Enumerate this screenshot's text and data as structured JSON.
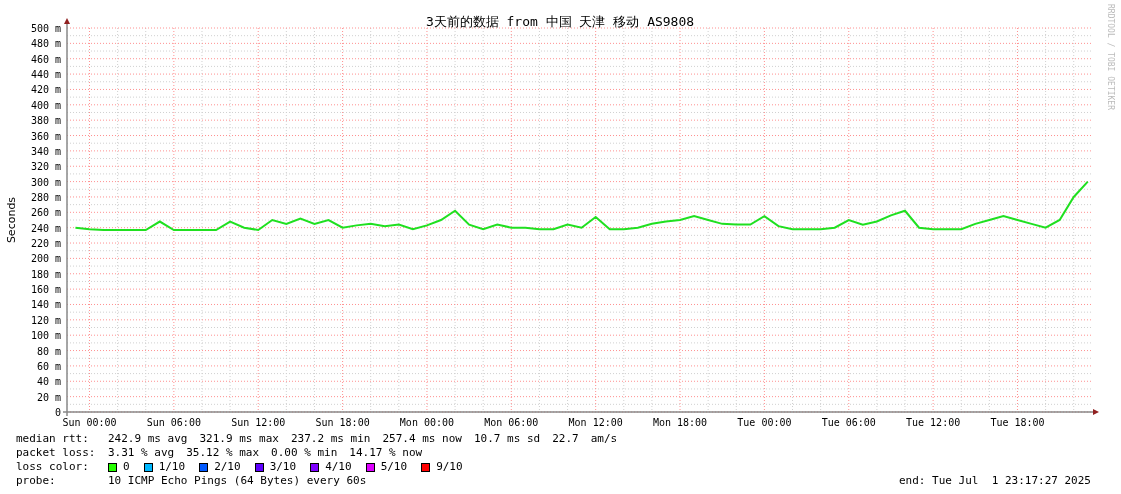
{
  "graph": {
    "watermark": "RRDTOOL / TOBI OETIKER",
    "chart_data": {
      "type": "line",
      "title": "3天前的数据 from 中国 天津 移动 AS9808",
      "ylabel": "Seconds",
      "categories": [
        null,
        "Sun 00:00",
        null,
        null,
        null,
        null,
        null,
        "Sun 06:00",
        null,
        null,
        null,
        null,
        null,
        "Sun 12:00",
        null,
        null,
        null,
        null,
        null,
        "Sun 18:00",
        null,
        null,
        null,
        null,
        null,
        "Mon 00:00",
        null,
        null,
        null,
        null,
        null,
        "Mon 06:00",
        null,
        null,
        null,
        null,
        null,
        "Mon 12:00",
        null,
        null,
        null,
        null,
        null,
        "Mon 18:00",
        null,
        null,
        null,
        null,
        null,
        "Tue 00:00",
        null,
        null,
        null,
        null,
        null,
        "Tue 06:00",
        null,
        null,
        null,
        null,
        null,
        "Tue 12:00",
        null,
        null,
        null,
        null,
        null,
        "Tue 18:00",
        null,
        null,
        null,
        null,
        null
      ],
      "series": [
        {
          "name": "median rtt:",
          "color": "#20e020",
          "values": [
            240,
            238,
            237,
            237,
            237,
            237,
            248,
            237,
            237,
            237,
            237,
            248,
            240,
            237,
            250,
            245,
            252,
            245,
            250,
            240,
            243,
            245,
            242,
            244,
            238,
            243,
            250,
            262,
            244,
            238,
            244,
            240,
            240,
            238,
            238,
            244,
            240,
            254,
            238,
            238,
            240,
            245,
            248,
            250,
            255,
            250,
            245,
            244,
            244,
            255,
            242,
            238,
            238,
            238,
            240,
            250,
            244,
            248,
            256,
            262,
            240,
            238,
            238,
            238,
            245,
            250,
            255,
            250,
            245,
            240,
            250,
            280,
            300
          ]
        }
      ],
      "grid": true,
      "ylim": [
        0,
        500
      ],
      "yticks": [
        {
          "value": 0,
          "label": "0"
        },
        {
          "value": 20,
          "label": "20 m"
        },
        {
          "value": 40,
          "label": "40 m"
        },
        {
          "value": 60,
          "label": "60 m"
        },
        {
          "value": 80,
          "label": "80 m"
        },
        {
          "value": 100,
          "label": "100 m"
        },
        {
          "value": 120,
          "label": "120 m"
        },
        {
          "value": 140,
          "label": "140 m"
        },
        {
          "value": 160,
          "label": "160 m"
        },
        {
          "value": 180,
          "label": "180 m"
        },
        {
          "value": 200,
          "label": "200 m"
        },
        {
          "value": 220,
          "label": "220 m"
        },
        {
          "value": 240,
          "label": "240 m"
        },
        {
          "value": 260,
          "label": "260 m"
        },
        {
          "value": 280,
          "label": "280 m"
        },
        {
          "value": 300,
          "label": "300 m"
        },
        {
          "value": 320,
          "label": "320 m"
        },
        {
          "value": 340,
          "label": "340 m"
        },
        {
          "value": 360,
          "label": "360 m"
        },
        {
          "value": 380,
          "label": "380 m"
        },
        {
          "value": 400,
          "label": "400 m"
        },
        {
          "value": 420,
          "label": "420 m"
        },
        {
          "value": 440,
          "label": "440 m"
        },
        {
          "value": 460,
          "label": "460 m"
        },
        {
          "value": 480,
          "label": "480 m"
        },
        {
          "value": 500,
          "label": "500 m"
        }
      ]
    }
  },
  "median_rtt": {
    "values": [
      "242.9 ms avg",
      "321.9 ms max",
      "237.2 ms min",
      "257.4 ms now",
      "10.7 ms sd",
      "22.7",
      "am/s"
    ]
  },
  "packet_loss": {
    "label": "packet loss:",
    "values": [
      "3.31 % avg",
      "35.12 % max",
      "0.00 % min",
      "14.17 % now"
    ]
  },
  "loss_color": {
    "label": "loss color:",
    "items": [
      {
        "label": "0",
        "color": "#26ff00"
      },
      {
        "label": "1/10",
        "color": "#00b8ff"
      },
      {
        "label": "2/10",
        "color": "#0059ff"
      },
      {
        "label": "3/10",
        "color": "#5e00ff"
      },
      {
        "label": "4/10",
        "color": "#7e00ff"
      },
      {
        "label": "5/10",
        "color": "#dd00ff"
      },
      {
        "label": "9/10",
        "color": "#ff0000"
      }
    ]
  },
  "probe": {
    "label": "probe:",
    "value": "10 ICMP Echo Pings (64 Bytes) every 60s"
  },
  "end": "end: Tue Jul  1 23:17:27 2025"
}
